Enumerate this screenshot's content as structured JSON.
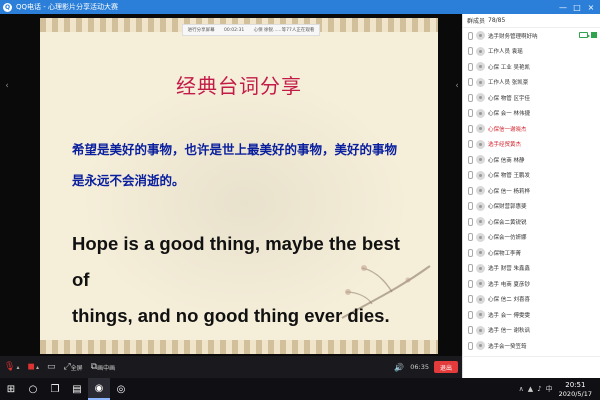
{
  "window": {
    "title": "QQ电话 - 心理影片分享活动大赛",
    "min_glyph": "—",
    "max_glyph": "□",
    "close_glyph": "×"
  },
  "slide": {
    "badge": {
      "label": "进行分享屏幕",
      "time": "00:02:31",
      "speaker": "心保 徐锐......等77人正在观看"
    },
    "title": "经典台词分享",
    "cn_lines": [
      "希望是美好的事物，也许是世上最美好的事物，美好的事物",
      "是永远不会消逝的。"
    ],
    "en_lines": [
      "Hope is a good thing, maybe the best of",
      "things, and no good thing ever dies."
    ]
  },
  "participants": {
    "header_label": "群成员",
    "count": "78/85",
    "list": [
      {
        "name": "选手财务管理啊好呐",
        "highlight": false,
        "camera": true
      },
      {
        "name": "工作人员 袁瑶",
        "highlight": false
      },
      {
        "name": "心保 工业 吴艳凯",
        "highlight": false
      },
      {
        "name": "工作人员 张凯豪",
        "highlight": false
      },
      {
        "name": "心保 物管 区宇佳",
        "highlight": false
      },
      {
        "name": "心保 会一 林伟捷",
        "highlight": false
      },
      {
        "name": "心保信一谢晓杰",
        "highlight": true
      },
      {
        "name": "选手经贸黄杰",
        "highlight": true
      },
      {
        "name": "心保 信商 林静",
        "highlight": false
      },
      {
        "name": "心保 物管 王鹏发",
        "highlight": false
      },
      {
        "name": "心保 信一 杨莉桦",
        "highlight": false
      },
      {
        "name": "心保财营郭惠斐",
        "highlight": false
      },
      {
        "name": "心保会二黄锐锐",
        "highlight": false
      },
      {
        "name": "心保会一仿妍娜",
        "highlight": false
      },
      {
        "name": "心保物工李菁",
        "highlight": false
      },
      {
        "name": "选手 财营 朱鑫鑫",
        "highlight": false
      },
      {
        "name": "选手 电商 夏彦钞",
        "highlight": false
      },
      {
        "name": "心保 信二 刘喜喜",
        "highlight": false
      },
      {
        "name": "选手 会一 傅雯雯",
        "highlight": false
      },
      {
        "name": "选手 信一 谢秋讽",
        "highlight": false
      },
      {
        "name": "选手会一癸笠筠",
        "highlight": false
      }
    ]
  },
  "controls": {
    "fullscreen_label": "全屏",
    "pip_label": "画中画",
    "timer": "06:35",
    "exit_label": "退出"
  },
  "taskbar": {
    "time": "20:51",
    "date": "2020/5/17"
  },
  "icons": {
    "mic": "mic-muted-icon",
    "camera": "camera-off-icon",
    "share": "share-screen-icon",
    "fullscreen": "fullscreen-icon",
    "pip": "picture-in-picture-icon",
    "volume": "volume-icon",
    "start": "windows-start-icon",
    "search": "search-icon",
    "taskview": "task-view-icon",
    "chrome": "chrome-icon"
  },
  "colors": {
    "title_bar": "#2b7fd9",
    "slide_title": "#c31a47",
    "cn_text": "#0a1f9e",
    "highlight_name": "#d0212b",
    "exit_button": "#e33b3b"
  }
}
